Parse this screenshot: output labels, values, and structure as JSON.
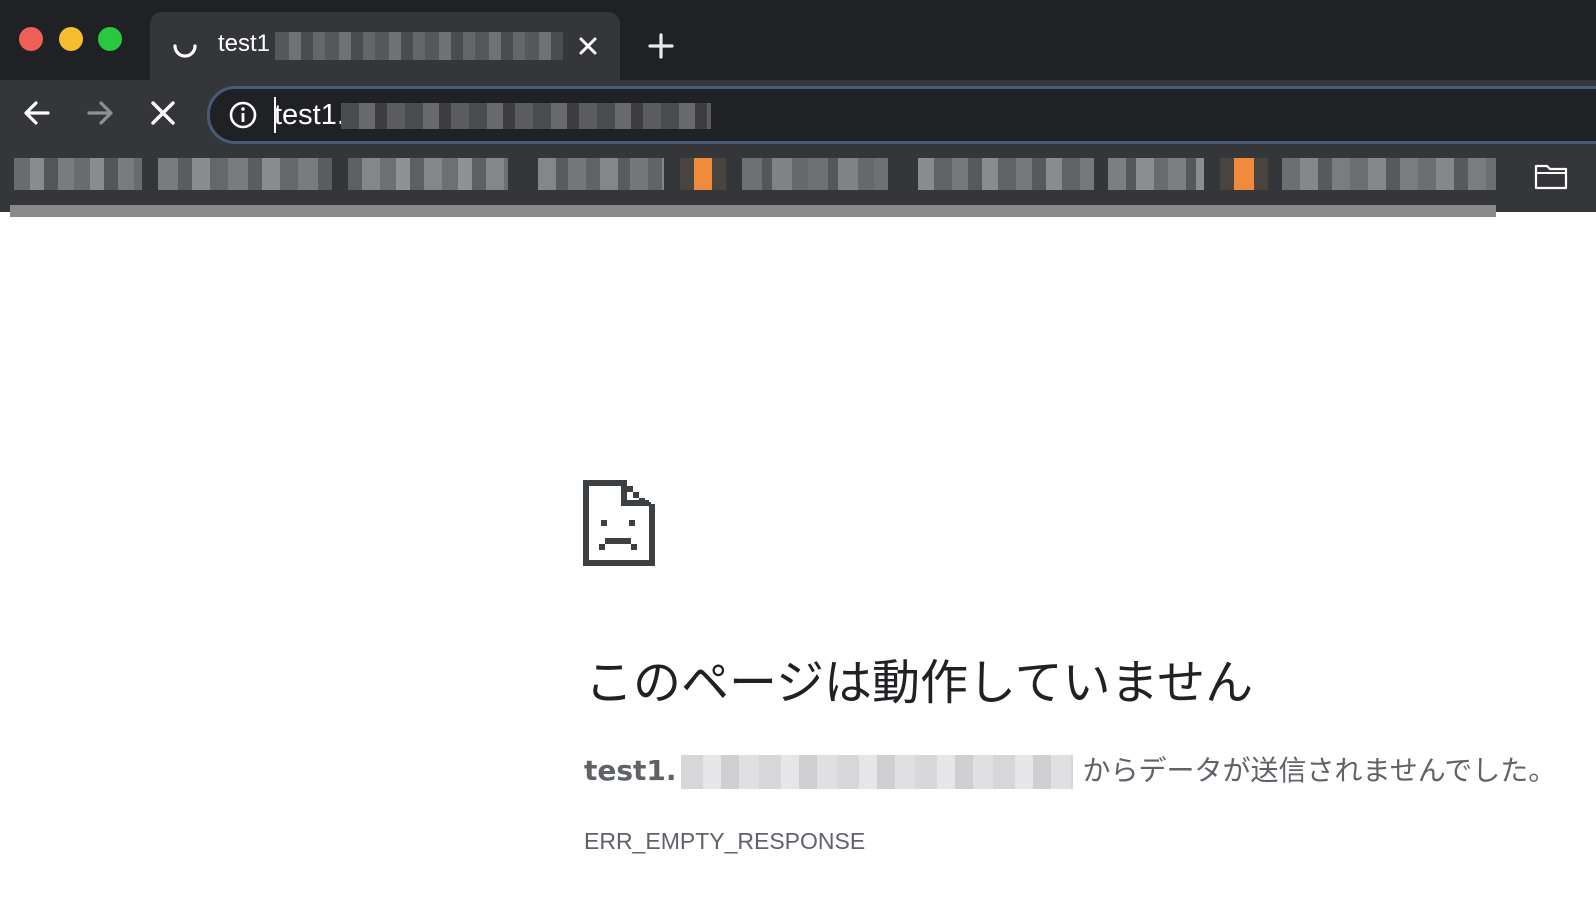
{
  "tab": {
    "title": "test1",
    "close_glyph": "✕",
    "loading_icon": "spinner-icon"
  },
  "new_tab_icon": "plus-icon",
  "toolbar": {
    "back_icon": "back-arrow-icon",
    "forward_icon": "forward-arrow-icon",
    "stop_icon": "stop-icon"
  },
  "omnibox": {
    "security_icon": "info-icon",
    "url": "test1."
  },
  "bookmarks_bar": {
    "folder_icon": "folder-icon"
  },
  "error_page": {
    "icon": "sad-page-icon",
    "heading": "このページは動作していません",
    "host": "test1.",
    "message_suffix": "からデータが送信されませんでした。",
    "error_code": "ERR_EMPTY_RESPONSE"
  },
  "colors": {
    "chrome_dark": "#202124",
    "toolbar": "#35363a",
    "traffic_close": "#ee5f58",
    "traffic_minimize": "#f5bd2f",
    "traffic_maximize": "#29c840",
    "error_text": "#5f6368",
    "heading_text": "#202124"
  }
}
